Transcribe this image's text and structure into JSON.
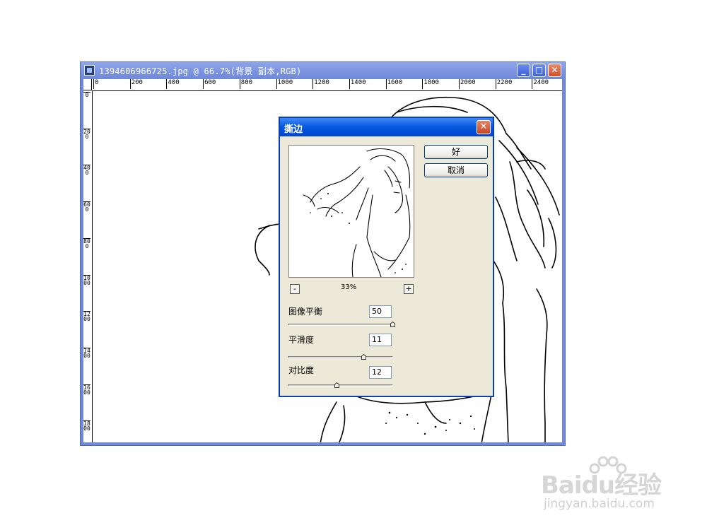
{
  "document_window": {
    "title": "1394606966725.jpg @ 66.7%(背景 副本,RGB)",
    "min_glyph": "_",
    "max_glyph": "□",
    "close_glyph": "✕",
    "ruler_h_labels": [
      "0",
      "200",
      "400",
      "600",
      "800",
      "1000",
      "1200",
      "1400",
      "1600",
      "1800",
      "2000",
      "2200",
      "2400"
    ],
    "ruler_v_labels": [
      "0",
      "200",
      "400",
      "600",
      "800",
      "1000",
      "1200",
      "1400",
      "1600",
      "1800"
    ]
  },
  "dialog": {
    "title": "撕边",
    "close_glyph": "✕",
    "ok_label": "好",
    "cancel_label": "取消",
    "zoom_out_glyph": "-",
    "zoom_in_glyph": "+",
    "zoom_level": "33%",
    "params": [
      {
        "label": "图像平衡",
        "value": "50",
        "slider_fraction": 1.0
      },
      {
        "label": "平滑度",
        "value": "11",
        "slider_fraction": 0.72
      },
      {
        "label": "对比度",
        "value": "12",
        "slider_fraction": 0.46
      }
    ]
  },
  "watermark": {
    "brand": "Baidu经验",
    "url": "jingyan.baidu.com"
  },
  "colors": {
    "dialog_title": "#0a5ae0",
    "doc_title": "#7a92e0",
    "dialog_face": "#ece9d8"
  }
}
